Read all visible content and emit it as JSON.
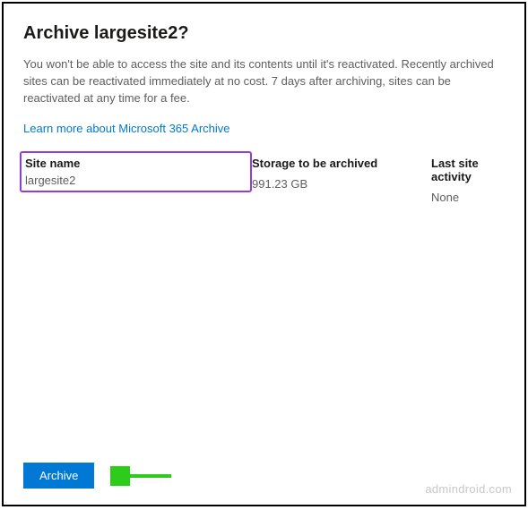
{
  "dialog": {
    "title": "Archive largesite2?",
    "description": "You won't be able to access the site and its contents until it's reactivated. Recently archived sites can be reactivated immediately at no cost. 7 days after archiving, sites can be reactivated at any time for a fee.",
    "learn_more": "Learn more about Microsoft 365 Archive"
  },
  "table": {
    "columns": {
      "site_name": "Site name",
      "storage": "Storage to be archived",
      "activity": "Last site activity"
    },
    "row": {
      "site_name": "largesite2",
      "storage": "991.23 GB",
      "activity": "None"
    }
  },
  "footer": {
    "archive_button": "Archive"
  },
  "annotations": {
    "arrow_color": "#2ecc1a",
    "highlight_color": "#8f3fd6"
  },
  "watermark": "admindroid.com"
}
